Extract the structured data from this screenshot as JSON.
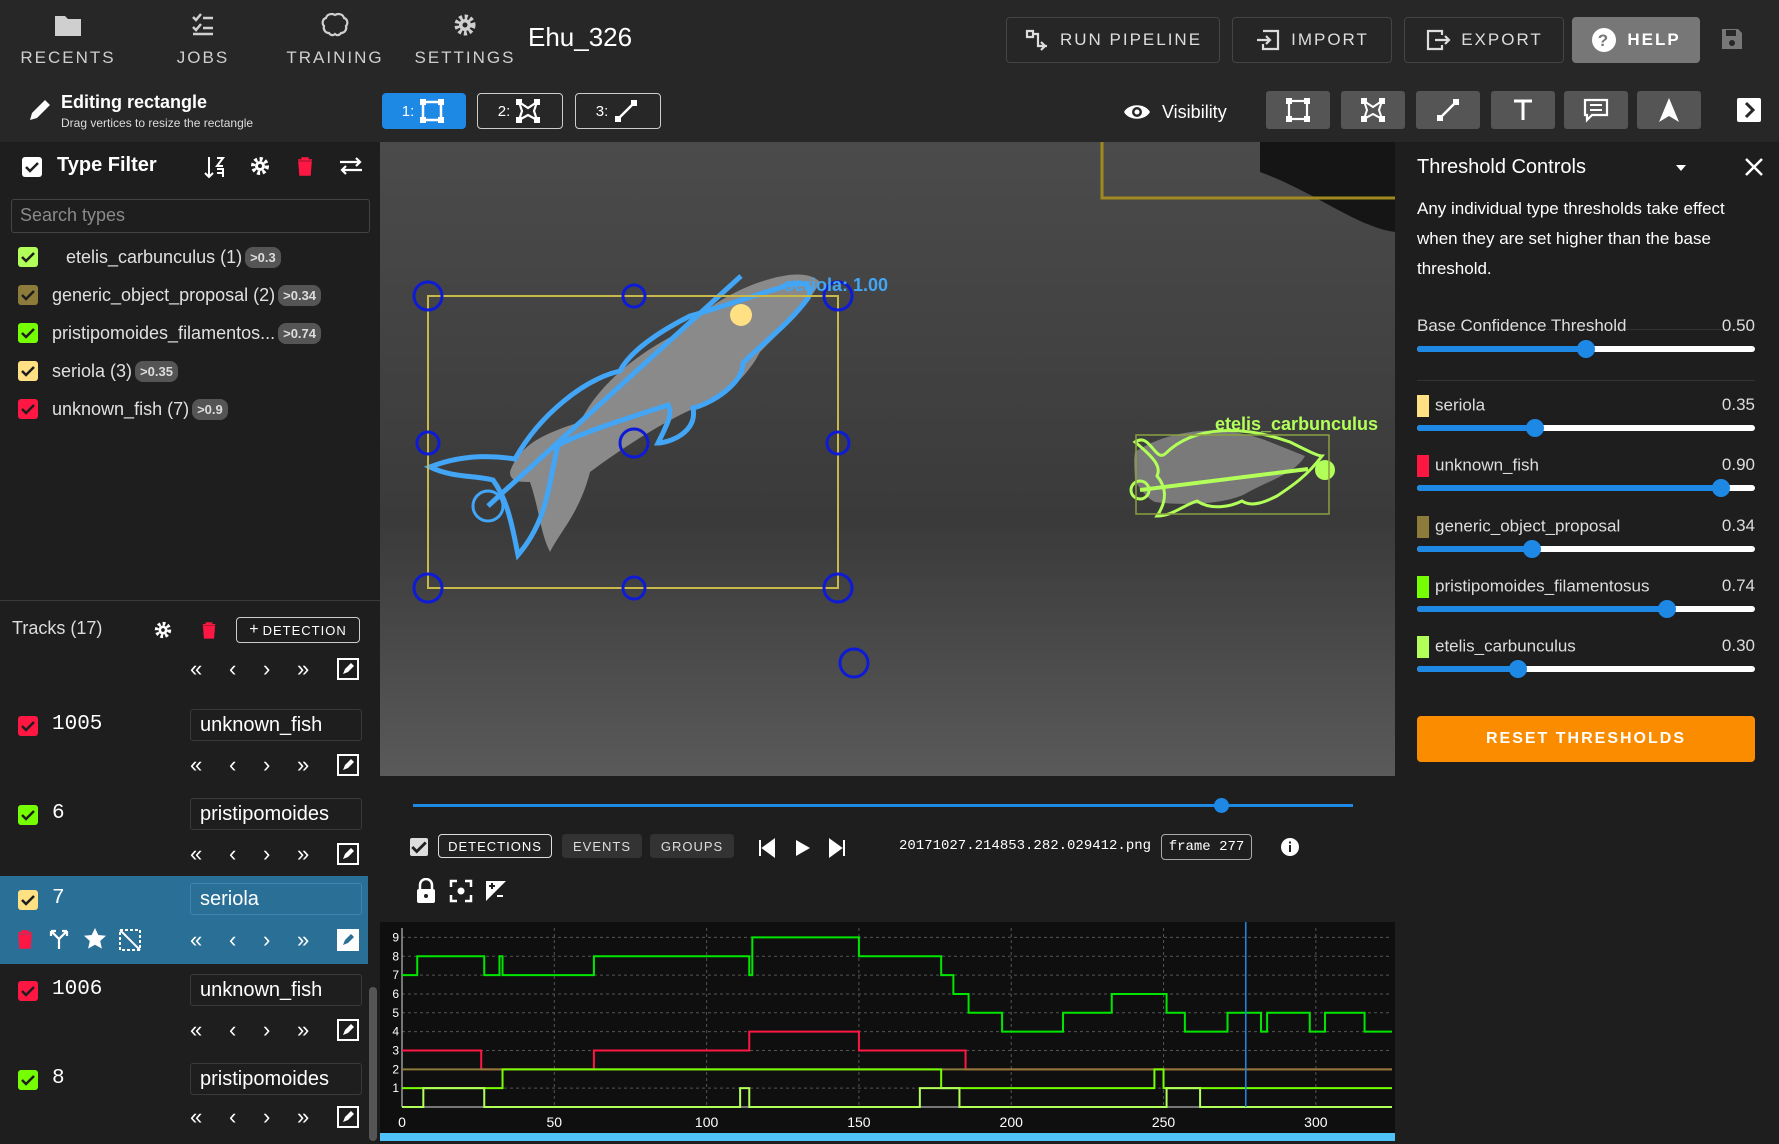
{
  "nav": [
    {
      "label": "RECENTS",
      "icon": "folder-icon"
    },
    {
      "label": "JOBS",
      "icon": "jobs-icon"
    },
    {
      "label": "TRAINING",
      "icon": "brain-icon"
    },
    {
      "label": "SETTINGS",
      "icon": "gear-icon"
    }
  ],
  "dataset_title": "Ehu_326",
  "toolbar": {
    "run_pipeline": "RUN PIPELINE",
    "import": "IMPORT",
    "export": "EXPORT",
    "help": "HELP"
  },
  "edit_mode": {
    "title": "Editing rectangle",
    "subtitle": "Drag vertices to resize the rectangle",
    "modes": [
      {
        "key": "1:",
        "name": "rectangle",
        "active": true
      },
      {
        "key": "2:",
        "name": "polygon",
        "active": false
      },
      {
        "key": "3:",
        "name": "line",
        "active": false
      }
    ]
  },
  "visibility": {
    "label": "Visibility"
  },
  "type_filter": {
    "title": "Type Filter",
    "search_placeholder": "Search types",
    "types": [
      {
        "name": "etelis_carbunculus (1)",
        "threshold": ">0.3",
        "color": "#b2ff59"
      },
      {
        "name": "generic_object_proposal (2)",
        "threshold": ">0.34",
        "color": "#8c7b3a"
      },
      {
        "name": "pristipomoides_filamentos...",
        "threshold": ">0.74",
        "color": "#76ff03"
      },
      {
        "name": "seriola (3)",
        "threshold": ">0.35",
        "color": "#ffe082"
      },
      {
        "name": "unknown_fish (7)",
        "threshold": ">0.9",
        "color": "#ff1744"
      }
    ]
  },
  "tracks": {
    "header": "Tracks (17)",
    "add_detection": "DETECTION",
    "items": [
      {
        "id": "1005",
        "type": "unknown_fish",
        "color": "#ff1744"
      },
      {
        "id": "6",
        "type": "pristipomoides",
        "color": "#76ff03"
      },
      {
        "id": "7",
        "type": "seriola",
        "color": "#ffe082",
        "selected": true
      },
      {
        "id": "1006",
        "type": "unknown_fish",
        "color": "#ff1744"
      },
      {
        "id": "8",
        "type": "pristipomoides",
        "color": "#76ff03"
      }
    ]
  },
  "viewer": {
    "labels": [
      {
        "text": "seriola: 1.00",
        "color": "#42a5f5"
      },
      {
        "text": "etelis_carbunculus",
        "color": "#b2ff59"
      }
    ]
  },
  "threshold_controls": {
    "title": "Threshold Controls",
    "description": "Any individual type thresholds take effect when they are set higher than the base threshold.",
    "base": {
      "label": "Base Confidence Threshold",
      "value": "0.50",
      "fraction": 0.5
    },
    "types": [
      {
        "name": "seriola",
        "value": "0.35",
        "fraction": 0.35,
        "color": "#ffe082"
      },
      {
        "name": "unknown_fish",
        "value": "0.90",
        "fraction": 0.9,
        "color": "#ff1744"
      },
      {
        "name": "generic_object_proposal",
        "value": "0.34",
        "fraction": 0.34,
        "color": "#8c7b3a"
      },
      {
        "name": "pristipomoides_filamentosus",
        "value": "0.74",
        "fraction": 0.74,
        "color": "#76ff03"
      },
      {
        "name": "etelis_carbunculus",
        "value": "0.30",
        "fraction": 0.3,
        "color": "#b2ff59"
      }
    ],
    "reset": "RESET THRESHOLDS"
  },
  "timeline": {
    "tabs": [
      "DETECTIONS",
      "EVENTS",
      "GROUPS"
    ],
    "filename": "20171027.214853.282.029412.png",
    "frame": "frame 277",
    "progress": 0.86
  },
  "chart_data": {
    "type": "line",
    "xlim": [
      0,
      325
    ],
    "ylim": [
      0,
      9.5
    ],
    "xticks": [
      0,
      50,
      100,
      150,
      200,
      250,
      300
    ],
    "yticks": [
      1,
      2,
      3,
      4,
      5,
      6,
      7,
      8,
      9
    ],
    "current_frame": 277,
    "grid": true,
    "series": [
      {
        "color": "#00e600",
        "step": [
          [
            0,
            7
          ],
          [
            5,
            8
          ],
          [
            27,
            7
          ],
          [
            32,
            8
          ],
          [
            33,
            7
          ],
          [
            63,
            8
          ],
          [
            114,
            7
          ],
          [
            115,
            9
          ],
          [
            150,
            8
          ],
          [
            177,
            7
          ],
          [
            181,
            6
          ],
          [
            186,
            5
          ],
          [
            197,
            4
          ],
          [
            217,
            5
          ],
          [
            233,
            6
          ],
          [
            251,
            5
          ],
          [
            257,
            4
          ],
          [
            271,
            5
          ],
          [
            282,
            4
          ],
          [
            284,
            5
          ],
          [
            298,
            4
          ],
          [
            303,
            5
          ],
          [
            316,
            4
          ],
          [
            325,
            4
          ]
        ]
      },
      {
        "color": "#ff1744",
        "step": [
          [
            0,
            3
          ],
          [
            26,
            2
          ],
          [
            63,
            3
          ],
          [
            114,
            4
          ],
          [
            150,
            3
          ],
          [
            185,
            2
          ],
          [
            325,
            2
          ]
        ]
      },
      {
        "color": "#8c7b3a",
        "step": [
          [
            0,
            2
          ],
          [
            325,
            2
          ]
        ]
      },
      {
        "color": "#76ff03",
        "step": [
          [
            0,
            1
          ],
          [
            33,
            2
          ],
          [
            177,
            1
          ],
          [
            247,
            2
          ],
          [
            250,
            1
          ],
          [
            325,
            1
          ]
        ]
      },
      {
        "color": "#b2ff59",
        "step": [
          [
            0,
            0
          ],
          [
            7,
            1
          ],
          [
            27,
            0
          ],
          [
            111,
            1
          ],
          [
            114,
            0
          ],
          [
            170,
            1
          ],
          [
            183,
            0
          ],
          [
            251,
            1
          ],
          [
            262,
            0
          ],
          [
            325,
            0
          ]
        ]
      }
    ]
  }
}
